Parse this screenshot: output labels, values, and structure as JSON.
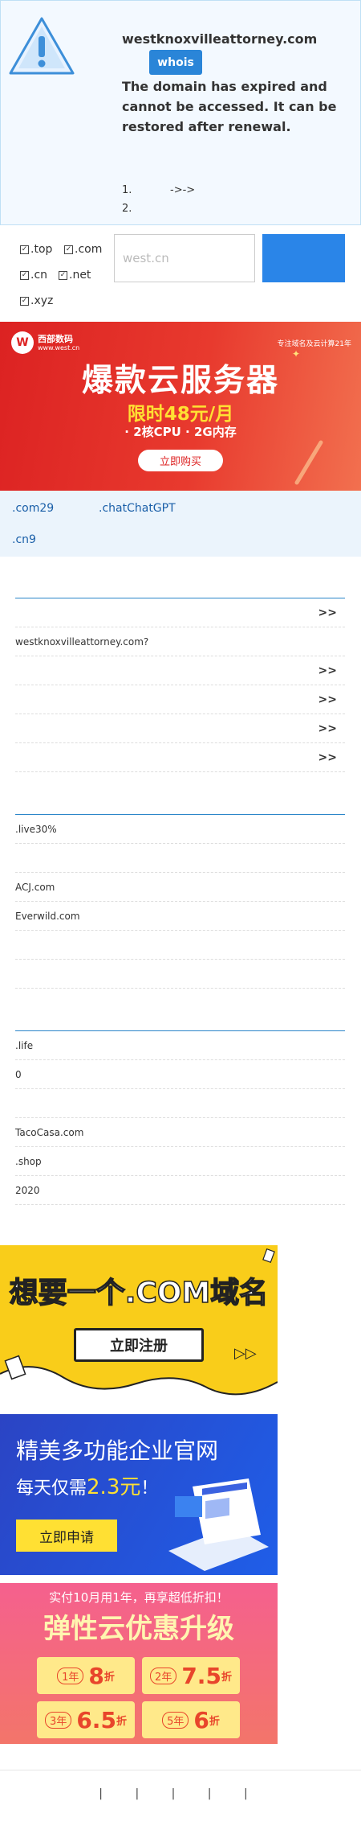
{
  "notice": {
    "domain": "westknoxvilleattorney.com",
    "whois_label": "whois",
    "message": "The domain has expired and cannot be accessed. It can be restored after renewal.",
    "steps": [
      {
        "num": "1.",
        "text": "->->"
      },
      {
        "num": "2.",
        "text": ""
      }
    ]
  },
  "search": {
    "checkboxes": [
      {
        "label": ".top",
        "checked": true
      },
      {
        "label": ".com",
        "checked": true
      },
      {
        "label": ".cn",
        "checked": true
      },
      {
        "label": ".net",
        "checked": true
      },
      {
        "label": ".xyz",
        "checked": true
      }
    ],
    "placeholder": "west.cn"
  },
  "banner_cloud": {
    "logo_name": "西部数码",
    "logo_url": "www.west.cn",
    "tagline": "专注域名及云计算21年",
    "headline": "爆款云服务器",
    "price": "限时48元/月",
    "spec": "· 2核CPU · 2G内存",
    "cta": "立即购买"
  },
  "promo_links": [
    ".com29",
    ".chatChatGPT",
    ".cn9"
  ],
  "section1": {
    "rows": [
      {
        "text": "",
        "arrow": ">>"
      },
      {
        "text": "westknoxvilleattorney.com?",
        "arrow": ""
      },
      {
        "text": "",
        "arrow": ">>"
      },
      {
        "text": "",
        "arrow": ">>"
      },
      {
        "text": "",
        "arrow": ">>"
      },
      {
        "text": "",
        "arrow": ">>"
      }
    ]
  },
  "section2": {
    "rows": [
      ".live30%",
      "",
      "ACJ.com",
      "Everwild.com",
      "",
      "",
      ""
    ]
  },
  "section3": {
    "rows": [
      ".life",
      "0",
      "",
      "TacoCasa.com",
      ".shop",
      "2020"
    ]
  },
  "ad_com": {
    "headline": "想要一个.COM域名",
    "cta": "立即注册",
    "arrows": "▷▷"
  },
  "ad_site": {
    "headline": "精美多功能企业官网",
    "sub_prefix": "每天仅需",
    "price": "2.3元",
    "sub_suffix": "！",
    "cta": "立即申请"
  },
  "ad_elastic": {
    "top": "实付10月用1年，再享超低折扣！",
    "headline": "弹性云优惠升级",
    "tiles": [
      {
        "years": "1年",
        "discount": "8",
        "unit": "折"
      },
      {
        "years": "2年",
        "discount": "7.5",
        "unit": "折"
      },
      {
        "years": "3年",
        "discount": "6.5",
        "unit": "折"
      },
      {
        "years": "5年",
        "discount": "6",
        "unit": "折"
      }
    ]
  },
  "footer": {
    "text": "| | | | |"
  },
  "colors": {
    "accent": "#2a85d8",
    "link": "#1a5fa8",
    "banner_red": "#dc2222",
    "yellow": "#f9cd1a"
  }
}
